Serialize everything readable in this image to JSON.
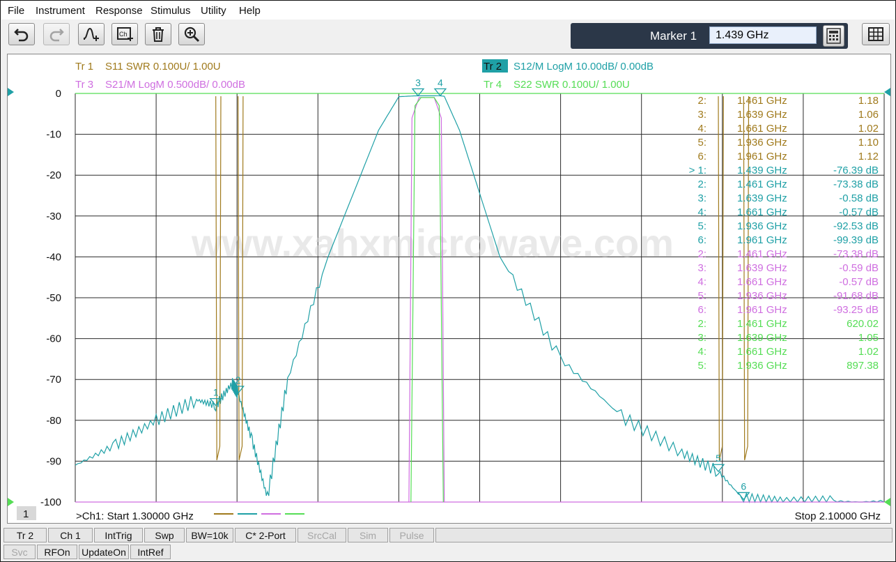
{
  "menu": [
    "File",
    "Instrument",
    "Response",
    "Stimulus",
    "Utility",
    "Help"
  ],
  "toolbar": {
    "buttons": [
      "undo-icon",
      "redo-icon",
      "marker-add-icon",
      "channel-add-icon",
      "trash-icon",
      "zoom-icon"
    ],
    "marker_label": "Marker 1",
    "marker_value": "1.439 GHz"
  },
  "traces": [
    {
      "id": "Tr 1",
      "desc": "S11 SWR 0.100U/  1.00U",
      "color": "#a07a1c"
    },
    {
      "id": "Tr 2",
      "desc": "S12/M LogM 10.00dB/  0.00dB",
      "color": "#1fa0a6"
    },
    {
      "id": "Tr 3",
      "desc": "S21/M LogM 0.500dB/  0.00dB",
      "color": "#cf6ee0"
    },
    {
      "id": "Tr 4",
      "desc": "S22 SWR 0.100U/  1.00U",
      "color": "#55dd55"
    }
  ],
  "chart_data": {
    "type": "line",
    "x_start_ghz": 1.3,
    "x_stop_ghz": 2.1,
    "ylim": [
      -100,
      0
    ],
    "yticks": [
      "0",
      "-10",
      "-20",
      "-30",
      "-40",
      "-50",
      "-60",
      "-70",
      "-80",
      "-90",
      "-100"
    ],
    "grid": true,
    "series": [
      {
        "name": "Tr 2 S12",
        "x": [
          1.3,
          1.34,
          1.38,
          1.42,
          1.439,
          1.455,
          1.461,
          1.475,
          1.49,
          1.51,
          1.55,
          1.6,
          1.62,
          1.635,
          1.639,
          1.661,
          1.665,
          1.68,
          1.72,
          1.78,
          1.84,
          1.9,
          1.936,
          1.961,
          2.0,
          2.05,
          2.1
        ],
        "y": [
          -91,
          -86,
          -80,
          -75,
          -76.39,
          -71,
          -73.38,
          -85,
          -99,
          -70,
          -40,
          -9,
          -0.8,
          -0.6,
          -0.58,
          -0.57,
          -0.7,
          -9,
          -40,
          -65,
          -79,
          -88,
          -92.53,
          -99.39,
          -100,
          -100,
          -100
        ]
      }
    ]
  },
  "marker_table": [
    {
      "idx": "2:",
      "freq": "1.461  GHz",
      "val": "1.18",
      "color": "#a07a1c"
    },
    {
      "idx": "3:",
      "freq": "1.639  GHz",
      "val": "1.06",
      "color": "#a07a1c"
    },
    {
      "idx": "4:",
      "freq": "1.661  GHz",
      "val": "1.02",
      "color": "#a07a1c"
    },
    {
      "idx": "5:",
      "freq": "1.936  GHz",
      "val": "1.10",
      "color": "#a07a1c"
    },
    {
      "idx": "6:",
      "freq": "1.961  GHz",
      "val": "1.12",
      "color": "#a07a1c"
    },
    {
      "idx": "> 1:",
      "freq": "1.439  GHz",
      "val": "-76.39 dB",
      "color": "#1fa0a6"
    },
    {
      "idx": "2:",
      "freq": "1.461  GHz",
      "val": "-73.38 dB",
      "color": "#1fa0a6"
    },
    {
      "idx": "3:",
      "freq": "1.639  GHz",
      "val": "-0.58 dB",
      "color": "#1fa0a6"
    },
    {
      "idx": "4:",
      "freq": "1.661  GHz",
      "val": "-0.57 dB",
      "color": "#1fa0a6"
    },
    {
      "idx": "5:",
      "freq": "1.936  GHz",
      "val": "-92.53 dB",
      "color": "#1fa0a6"
    },
    {
      "idx": "6:",
      "freq": "1.961  GHz",
      "val": "-99.39 dB",
      "color": "#1fa0a6"
    },
    {
      "idx": "2:",
      "freq": "1.461  GHz",
      "val": "-73.38 dB",
      "color": "#cf6ee0"
    },
    {
      "idx": "3:",
      "freq": "1.639  GHz",
      "val": "-0.59 dB",
      "color": "#cf6ee0"
    },
    {
      "idx": "4:",
      "freq": "1.661  GHz",
      "val": "-0.57 dB",
      "color": "#cf6ee0"
    },
    {
      "idx": "5:",
      "freq": "1.936  GHz",
      "val": "-91.68 dB",
      "color": "#cf6ee0"
    },
    {
      "idx": "6:",
      "freq": "1.961  GHz",
      "val": "-93.25 dB",
      "color": "#cf6ee0"
    },
    {
      "idx": "2:",
      "freq": "1.461  GHz",
      "val": "620.02",
      "color": "#55dd55"
    },
    {
      "idx": "3:",
      "freq": "1.639  GHz",
      "val": "1.05",
      "color": "#55dd55"
    },
    {
      "idx": "4:",
      "freq": "1.661  GHz",
      "val": "1.02",
      "color": "#55dd55"
    },
    {
      "idx": "5:",
      "freq": "1.936  GHz",
      "val": "897.38",
      "color": "#55dd55"
    }
  ],
  "watermark": "www.xahxmicrowave.com",
  "channel_num": "1",
  "start_label": ">Ch1:  Start   1.30000 GHz",
  "stop_label": "Stop  2.10000 GHz",
  "status_row1": [
    {
      "label": "Tr 2",
      "enabled": true
    },
    {
      "label": "Ch 1",
      "enabled": true
    },
    {
      "label": "IntTrig",
      "enabled": true
    },
    {
      "label": "Swp",
      "enabled": true
    },
    {
      "label": "BW=10k",
      "enabled": true
    },
    {
      "label": "C* 2-Port",
      "enabled": true
    },
    {
      "label": "SrcCal",
      "enabled": false
    },
    {
      "label": "Sim",
      "enabled": false
    },
    {
      "label": "Pulse",
      "enabled": false
    }
  ],
  "status_row2": [
    {
      "label": "Svc",
      "enabled": false
    },
    {
      "label": "RFOn",
      "enabled": true
    },
    {
      "label": "UpdateOn",
      "enabled": true
    },
    {
      "label": "IntRef",
      "enabled": true
    }
  ],
  "markers": {
    "s12": [
      {
        "n": "1",
        "f": 1.439,
        "y": -76.39
      },
      {
        "n": "2",
        "f": 1.461,
        "y": -73.38
      },
      {
        "n": "3",
        "f": 1.639,
        "y": -0.58
      },
      {
        "n": "4",
        "f": 1.661,
        "y": -0.57
      },
      {
        "n": "5",
        "f": 1.936,
        "y": -92.53
      },
      {
        "n": "6",
        "f": 1.961,
        "y": -99.39
      }
    ]
  }
}
